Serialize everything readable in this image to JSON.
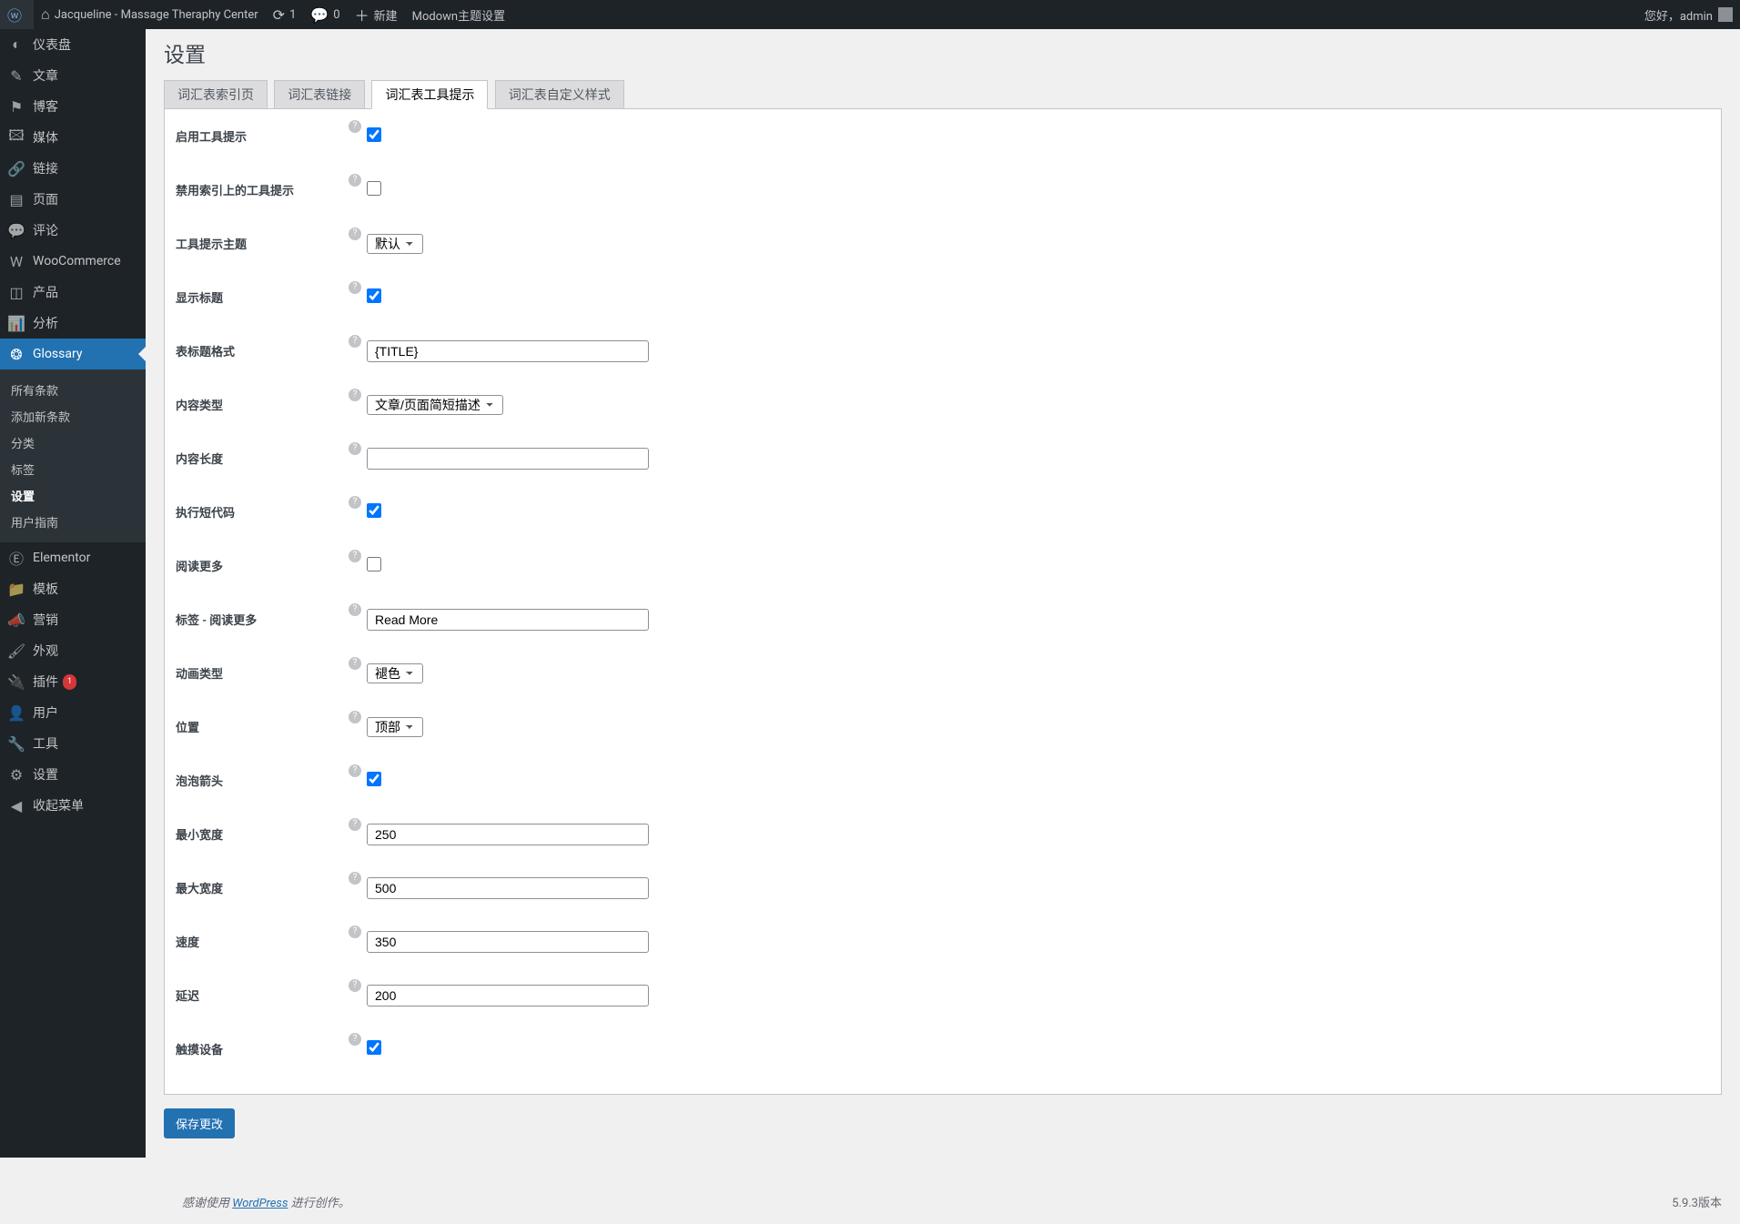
{
  "adminbar": {
    "site_name": "Jacqueline - Massage Theraphy Center",
    "updates_count": "1",
    "comments_count": "0",
    "new_label": "新建",
    "theme_settings": "Modown主题设置",
    "greeting": "您好，admin"
  },
  "sidebar": {
    "items": [
      {
        "icon": "◐",
        "label": "仪表盘"
      },
      {
        "icon": "✎",
        "label": "文章"
      },
      {
        "icon": "⚑",
        "label": "博客"
      },
      {
        "icon": "🖾",
        "label": "媒体"
      },
      {
        "icon": "🔗",
        "label": "链接"
      },
      {
        "icon": "▤",
        "label": "页面"
      },
      {
        "icon": "💬",
        "label": "评论"
      },
      {
        "icon": "W",
        "label": "WooCommerce"
      },
      {
        "icon": "◫",
        "label": "产品"
      },
      {
        "icon": "📊",
        "label": "分析"
      },
      {
        "icon": "❂",
        "label": "Glossary"
      },
      {
        "icon": "Ⓔ",
        "label": "Elementor"
      },
      {
        "icon": "📁",
        "label": "模板"
      },
      {
        "icon": "📣",
        "label": "营销"
      },
      {
        "icon": "🖌",
        "label": "外观"
      },
      {
        "icon": "🔌",
        "label": "插件"
      },
      {
        "icon": "👤",
        "label": "用户"
      },
      {
        "icon": "🔧",
        "label": "工具"
      },
      {
        "icon": "⚙",
        "label": "设置"
      },
      {
        "icon": "◀",
        "label": "收起菜单"
      }
    ],
    "plugin_count": "1",
    "submenu": [
      {
        "label": "所有条款"
      },
      {
        "label": "添加新条款"
      },
      {
        "label": "分类"
      },
      {
        "label": "标签"
      },
      {
        "label": "设置"
      },
      {
        "label": "用户指南"
      }
    ]
  },
  "page": {
    "title": "设置",
    "tabs": [
      {
        "label": "词汇表索引页"
      },
      {
        "label": "词汇表链接"
      },
      {
        "label": "词汇表工具提示"
      },
      {
        "label": "词汇表自定义样式"
      }
    ]
  },
  "form": {
    "enable_tooltip": {
      "label": "启用工具提示",
      "checked": true
    },
    "disable_on_index": {
      "label": "禁用索引上的工具提示",
      "checked": false
    },
    "tooltip_theme": {
      "label": "工具提示主题",
      "value": "默认"
    },
    "show_title": {
      "label": "显示标题",
      "checked": true
    },
    "title_format": {
      "label": "表标题格式",
      "value": "{TITLE}"
    },
    "content_type": {
      "label": "内容类型",
      "value": "文章/页面简短描述"
    },
    "content_length": {
      "label": "内容长度",
      "value": ""
    },
    "exec_shortcode": {
      "label": "执行短代码",
      "checked": true
    },
    "read_more": {
      "label": "阅读更多",
      "checked": false
    },
    "read_more_label": {
      "label": "标签 - 阅读更多",
      "value": "Read More"
    },
    "animation_type": {
      "label": "动画类型",
      "value": "褪色"
    },
    "position": {
      "label": "位置",
      "value": "顶部"
    },
    "bubble_arrow": {
      "label": "泡泡箭头",
      "checked": true
    },
    "min_width": {
      "label": "最小宽度",
      "value": "250"
    },
    "max_width": {
      "label": "最大宽度",
      "value": "500"
    },
    "speed": {
      "label": "速度",
      "value": "350"
    },
    "delay": {
      "label": "延迟",
      "value": "200"
    },
    "touch_device": {
      "label": "触摸设备",
      "checked": true
    },
    "save_button": "保存更改"
  },
  "footer": {
    "thanks_prefix": "感谢使用 ",
    "wordpress": "WordPress",
    "thanks_suffix": " 进行创作。",
    "version": "5.9.3版本"
  }
}
